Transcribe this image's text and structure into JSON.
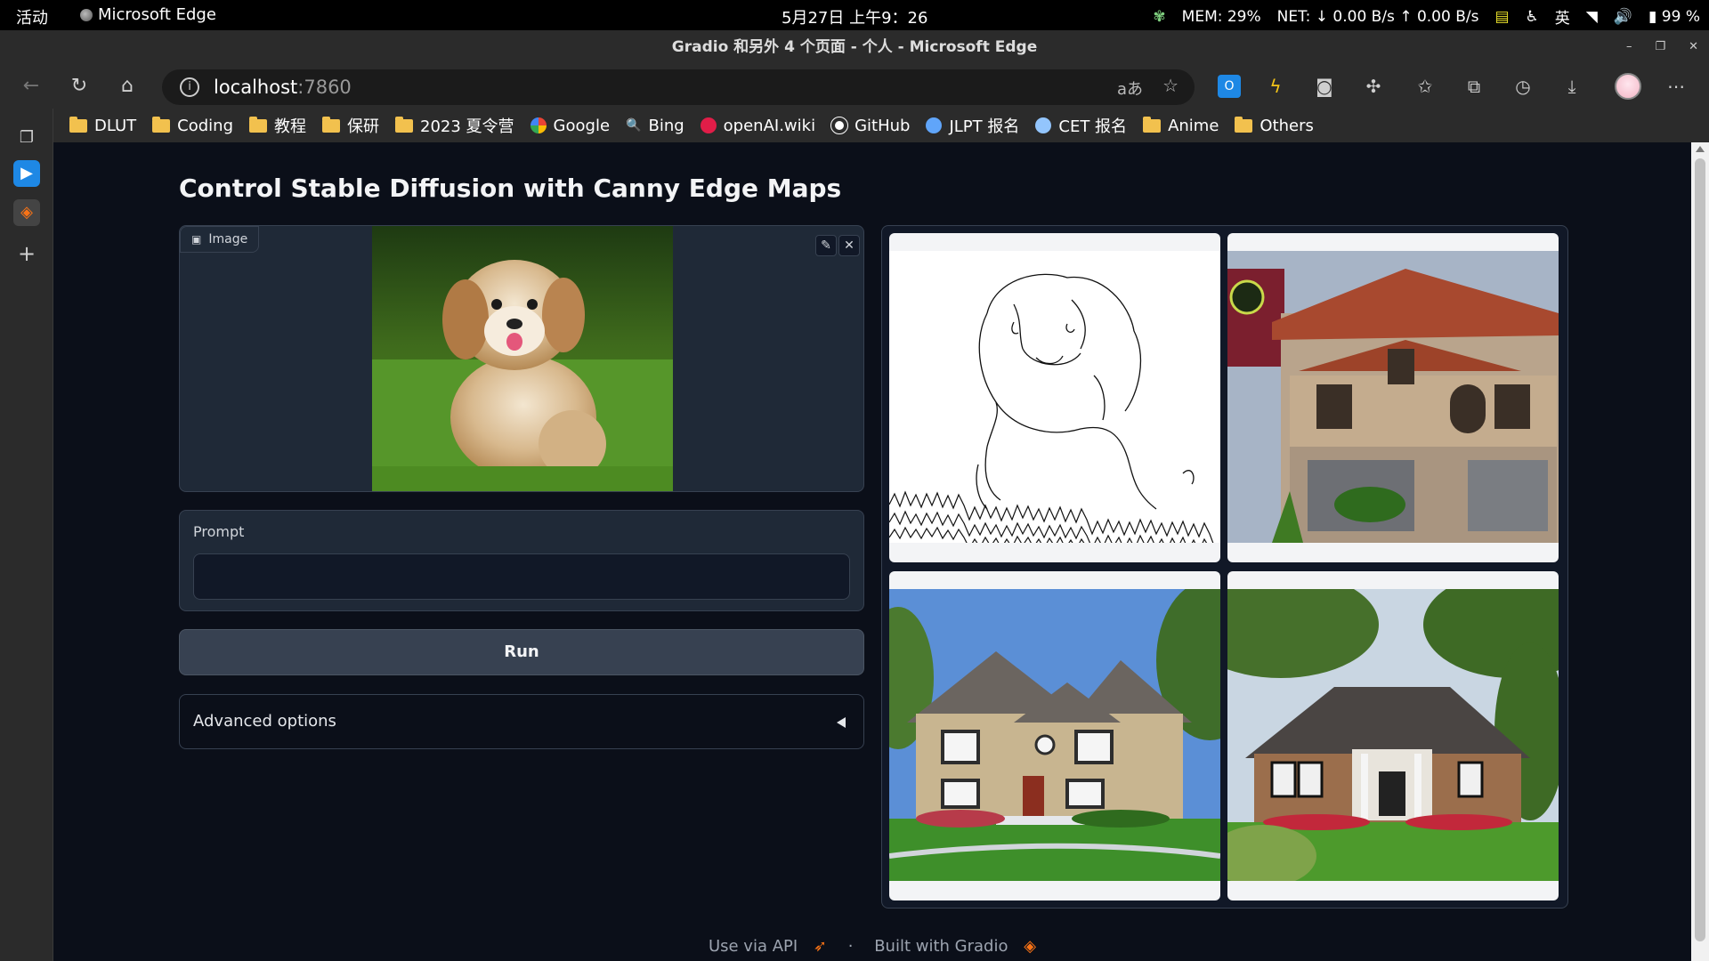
{
  "os": {
    "activities": "活动",
    "app_name": "Microsoft Edge",
    "clock": "5月27日 上午9：26",
    "mem": "MEM: 29%",
    "net": "NET: ↓  0.00 B/s ↑  0.00 B/s",
    "ime": "英",
    "battery": "99 %"
  },
  "window": {
    "title": "Gradio 和另外 4 个页面 - 个人 - Microsoft Edge"
  },
  "address": {
    "host": "localhost",
    "port": ":7860"
  },
  "bookmarks": [
    {
      "label": "DLUT",
      "icon": "folder-icon"
    },
    {
      "label": "Coding",
      "icon": "folder-icon"
    },
    {
      "label": "教程",
      "icon": "folder-icon"
    },
    {
      "label": "保研",
      "icon": "folder-icon"
    },
    {
      "label": "2023 夏令营",
      "icon": "folder-icon"
    },
    {
      "label": "Google",
      "icon": "google-icon"
    },
    {
      "label": "Bing",
      "icon": "bing-icon"
    },
    {
      "label": "openAI.wiki",
      "icon": "openai-icon"
    },
    {
      "label": "GitHub",
      "icon": "github-icon"
    },
    {
      "label": "JLPT 报名",
      "icon": "jlpt-icon"
    },
    {
      "label": "CET 报名",
      "icon": "cet-icon"
    },
    {
      "label": "Anime",
      "icon": "folder-icon"
    },
    {
      "label": "Others",
      "icon": "folder-icon"
    }
  ],
  "main": {
    "title": "Control Stable Diffusion with Canny Edge Maps",
    "image_label": "Image",
    "prompt_label": "Prompt",
    "prompt_value": "",
    "run_label": "Run",
    "advanced_label": "Advanced options"
  },
  "footer": {
    "api": "Use via API",
    "dot": "·",
    "built": "Built with Gradio"
  },
  "colors": {
    "page_bg": "#0b0f19",
    "panel_bg": "#1f2937",
    "border": "#374151",
    "button_bg": "#374151"
  }
}
